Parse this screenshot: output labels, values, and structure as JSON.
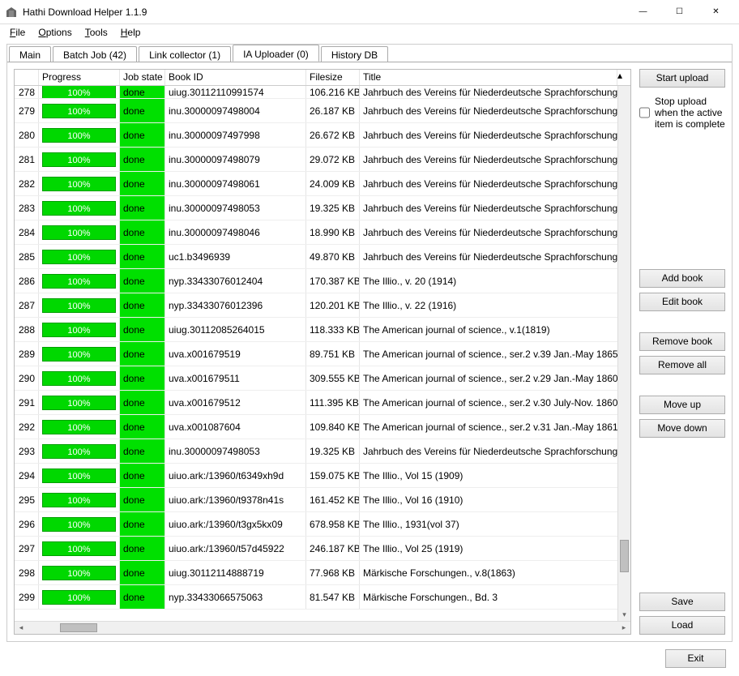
{
  "window": {
    "title": "Hathi Download Helper 1.1.9"
  },
  "menu": {
    "file": "File",
    "options": "Options",
    "tools": "Tools",
    "help": "Help"
  },
  "tabs": [
    {
      "label": "Main"
    },
    {
      "label": "Batch Job (42)"
    },
    {
      "label": "Link collector (1)"
    },
    {
      "label": "IA Uploader (0)",
      "active": true
    },
    {
      "label": "History DB"
    }
  ],
  "columns": {
    "index": "",
    "progress": "Progress",
    "state": "Job state",
    "bookid": "Book ID",
    "filesize": "Filesize",
    "title": "Title"
  },
  "partial_top": {
    "idx": "278",
    "progress": "100%",
    "state": "done",
    "bookid": "uiug.30112110991574",
    "filesize": "106.216 KB",
    "title": "Jahrbuch des Vereins für Niederdeutsche Sprachforschung., v"
  },
  "rows": [
    {
      "idx": "279",
      "progress": "100%",
      "state": "done",
      "bookid": "inu.30000097498004",
      "filesize": "26.187 KB",
      "title": "Jahrbuch des Vereins für Niederdeutsche Sprachforschung., v"
    },
    {
      "idx": "280",
      "progress": "100%",
      "state": "done",
      "bookid": "inu.30000097497998",
      "filesize": "26.672 KB",
      "title": "Jahrbuch des Vereins für Niederdeutsche Sprachforschung., v"
    },
    {
      "idx": "281",
      "progress": "100%",
      "state": "done",
      "bookid": "inu.30000097498079",
      "filesize": "29.072 KB",
      "title": "Jahrbuch des Vereins für Niederdeutsche Sprachforschung., v"
    },
    {
      "idx": "282",
      "progress": "100%",
      "state": "done",
      "bookid": "inu.30000097498061",
      "filesize": "24.009 KB",
      "title": "Jahrbuch des Vereins für Niederdeutsche Sprachforschung., v"
    },
    {
      "idx": "283",
      "progress": "100%",
      "state": "done",
      "bookid": "inu.30000097498053",
      "filesize": "19.325 KB",
      "title": "Jahrbuch des Vereins für Niederdeutsche Sprachforschung., v"
    },
    {
      "idx": "284",
      "progress": "100%",
      "state": "done",
      "bookid": "inu.30000097498046",
      "filesize": "18.990 KB",
      "title": "Jahrbuch des Vereins für Niederdeutsche Sprachforschung., v"
    },
    {
      "idx": "285",
      "progress": "100%",
      "state": "done",
      "bookid": "uc1.b3496939",
      "filesize": "49.870 KB",
      "title": "Jahrbuch des Vereins für Niederdeutsche Sprachforschung., v"
    },
    {
      "idx": "286",
      "progress": "100%",
      "state": "done",
      "bookid": "nyp.33433076012404",
      "filesize": "170.387 KB",
      "title": "The Illio., v. 20 (1914)"
    },
    {
      "idx": "287",
      "progress": "100%",
      "state": "done",
      "bookid": "nyp.33433076012396",
      "filesize": "120.201 KB",
      "title": "The Illio., v. 22 (1916)"
    },
    {
      "idx": "288",
      "progress": "100%",
      "state": "done",
      "bookid": "uiug.30112085264015",
      "filesize": "118.333 KB",
      "title": "The American journal of science., v.1(1819)"
    },
    {
      "idx": "289",
      "progress": "100%",
      "state": "done",
      "bookid": "uva.x001679519",
      "filesize": "89.751 KB",
      "title": "The American journal of science., ser.2 v.39 Jan.-May 1865"
    },
    {
      "idx": "290",
      "progress": "100%",
      "state": "done",
      "bookid": "uva.x001679511",
      "filesize": "309.555 KB",
      "title": "The American journal of science., ser.2 v.29 Jan.-May 1860"
    },
    {
      "idx": "291",
      "progress": "100%",
      "state": "done",
      "bookid": "uva.x001679512",
      "filesize": "111.395 KB",
      "title": "The American journal of science., ser.2 v.30 July-Nov. 1860"
    },
    {
      "idx": "292",
      "progress": "100%",
      "state": "done",
      "bookid": "uva.x001087604",
      "filesize": "109.840 KB",
      "title": "The American journal of science., ser.2 v.31 Jan.-May 1861"
    },
    {
      "idx": "293",
      "progress": "100%",
      "state": "done",
      "bookid": "inu.30000097498053",
      "filesize": "19.325 KB",
      "title": "Jahrbuch des Vereins für Niederdeutsche Sprachforschung., v"
    },
    {
      "idx": "294",
      "progress": "100%",
      "state": "done",
      "bookid": "uiuo.ark:/13960/t6349xh9d",
      "filesize": "159.075 KB",
      "title": "The Illio., Vol 15 (1909)"
    },
    {
      "idx": "295",
      "progress": "100%",
      "state": "done",
      "bookid": "uiuo.ark:/13960/t9378n41s",
      "filesize": "161.452 KB",
      "title": "The Illio., Vol 16 (1910)"
    },
    {
      "idx": "296",
      "progress": "100%",
      "state": "done",
      "bookid": "uiuo.ark:/13960/t3gx5kx09",
      "filesize": "678.958 KB",
      "title": "The Illio., 1931(vol 37)"
    },
    {
      "idx": "297",
      "progress": "100%",
      "state": "done",
      "bookid": "uiuo.ark:/13960/t57d45922",
      "filesize": "246.187 KB",
      "title": "The Illio., Vol 25 (1919)"
    },
    {
      "idx": "298",
      "progress": "100%",
      "state": "done",
      "bookid": "uiug.30112114888719",
      "filesize": "77.968 KB",
      "title": "Märkische Forschungen., v.8(1863)"
    },
    {
      "idx": "299",
      "progress": "100%",
      "state": "done",
      "bookid": "nyp.33433066575063",
      "filesize": "81.547 KB",
      "title": "Märkische Forschungen., Bd. 3"
    }
  ],
  "side": {
    "start": "Start upload",
    "stop_label": "Stop upload when the active item is complete",
    "add": "Add book",
    "edit": "Edit book",
    "removebook": "Remove book",
    "removeall": "Remove all",
    "moveup": "Move up",
    "movedown": "Move down",
    "save": "Save",
    "load": "Load"
  },
  "footer": {
    "exit": "Exit"
  }
}
